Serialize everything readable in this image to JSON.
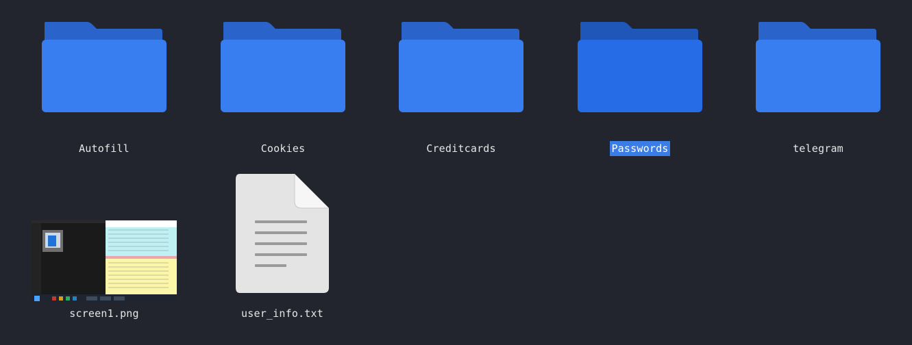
{
  "folders": [
    {
      "name": "Autofill",
      "icon": "folder-icon",
      "selected": false
    },
    {
      "name": "Cookies",
      "icon": "folder-icon",
      "selected": false
    },
    {
      "name": "Creditcards",
      "icon": "folder-icon",
      "selected": false
    },
    {
      "name": "Passwords",
      "icon": "folder-icon",
      "selected": true
    },
    {
      "name": "telegram",
      "icon": "folder-icon",
      "selected": false
    }
  ],
  "files": [
    {
      "name": "screen1.png",
      "icon": "image-thumbnail"
    },
    {
      "name": "user_info.txt",
      "icon": "text-document-icon"
    }
  ],
  "colors": {
    "background": "#22252e",
    "folder_front": "#387ef0",
    "folder_back": "#2a63c9",
    "folder_selected": "#256ce6",
    "selection_highlight": "#3a7de6",
    "text": "#e6e6e6"
  }
}
